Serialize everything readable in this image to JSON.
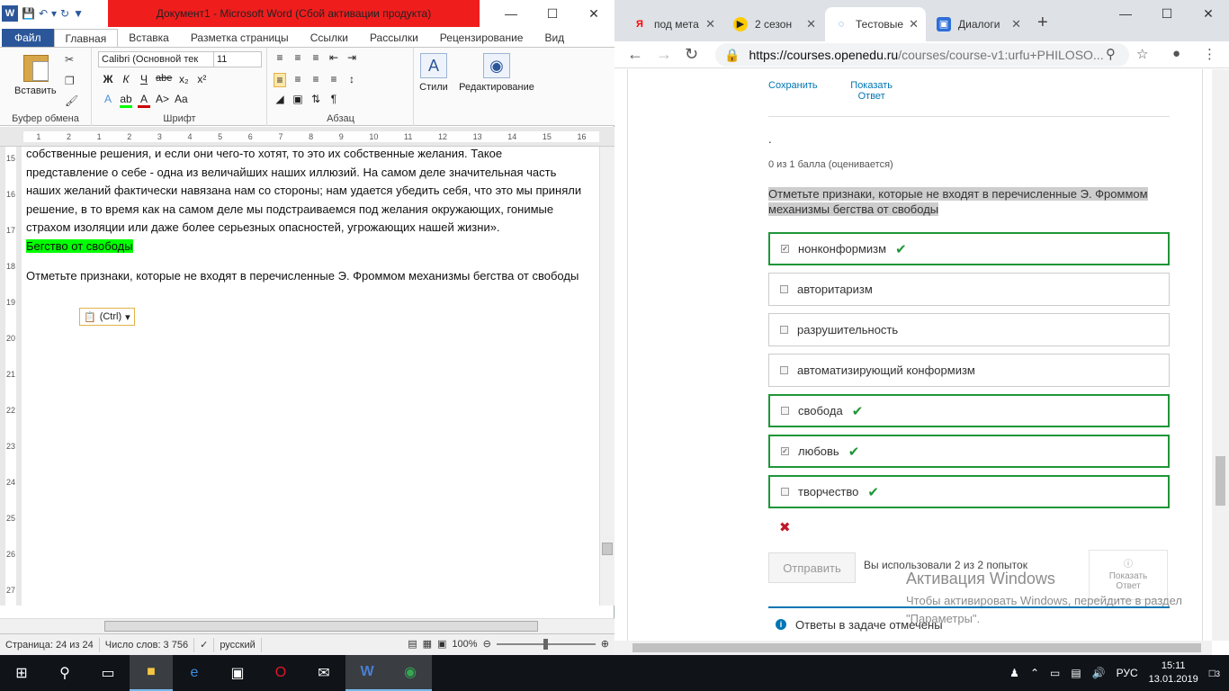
{
  "word": {
    "title": "Документ1  -  Microsoft Word (Сбой активации продукта)",
    "tabs": [
      "Файл",
      "Главная",
      "Вставка",
      "Разметка страницы",
      "Ссылки",
      "Рассылки",
      "Рецензирование",
      "Вид"
    ],
    "ribbon": {
      "paste_label": "Вставить",
      "font_name": "Calibri (Основной тек",
      "font_size": "11",
      "styles_label": "Стили",
      "editing_label": "Редактирование",
      "groups": {
        "clipboard": "Буфер обмена",
        "font": "Шрифт",
        "paragraph": "Абзац"
      },
      "format_buttons": [
        "Ж",
        "К",
        "Ч",
        "abe",
        "x₂",
        "x²"
      ]
    },
    "ruler_ticks": [
      "1",
      "2",
      "1",
      "2",
      "3",
      "4",
      "5",
      "6",
      "7",
      "8",
      "9",
      "10",
      "11",
      "12",
      "13",
      "14",
      "15",
      "16"
    ],
    "vruler_ticks": [
      "15",
      "16",
      "17",
      "18",
      "19",
      "20",
      "21",
      "22",
      "23",
      "24",
      "25",
      "26",
      "27"
    ],
    "document": {
      "para1": "собственные решения, и если они чего-то хотят, то это их собственные желания. Такое представление о себе - одна из величайших наших иллюзий. На самом деле значительная часть наших желаний фактически навязана нам со стороны; нам удается убедить себя, что это мы приняли решение, в то время как на самом деле мы подстраиваемся под желания окружающих, гонимые страхом изоляции или даже более серьезных опасностей, угрожающих нашей жизни».",
      "highlight": "Бегство от свободы",
      "para2": "Отметьте признаки, которые не входят в перечисленные Э. Фроммом механизмы бегства от свободы",
      "paste_tag": "(Ctrl)"
    },
    "status": {
      "page": "Страница: 24 из 24",
      "words": "Число слов: 3 756",
      "lang": "русский",
      "zoom": "100%"
    }
  },
  "browser": {
    "tabs": [
      {
        "label": "под мета",
        "icon": "Я",
        "color": "#ff0000"
      },
      {
        "label": "2 сезон",
        "icon": "▶",
        "color": "#ffcc00"
      },
      {
        "label": "Тестовые",
        "icon": "◌",
        "color": "#1a73e8"
      },
      {
        "label": "Диалоги",
        "icon": "▣",
        "color": "#2d6ed8"
      }
    ],
    "url_host": "https://courses.openedu.ru",
    "url_path": "/courses/course-v1:urfu+PHILOSO...",
    "top_actions": {
      "save": "Сохранить",
      "show_answer": "Показать Ответ"
    },
    "dot": ".",
    "score": "0 из 1 балла (оценивается)",
    "question": "Отметьте признаки, которые не входят в перечисленные Э. Фроммом механизмы бегства от свободы",
    "options": [
      {
        "label": "нонконформизм",
        "checked": true,
        "correct": true
      },
      {
        "label": "авторитаризм",
        "checked": false,
        "correct": false
      },
      {
        "label": "разрушительность",
        "checked": false,
        "correct": false
      },
      {
        "label": "автоматизирующий конформизм",
        "checked": false,
        "correct": false
      },
      {
        "label": "свобода",
        "checked": false,
        "correct": true
      },
      {
        "label": "любовь",
        "checked": true,
        "correct": true
      },
      {
        "label": "творчество",
        "checked": false,
        "correct": true
      }
    ],
    "submit_label": "Отправить",
    "attempts": "Вы использовали 2 из 2 попыток",
    "show_answer": "Показать Ответ",
    "info": "Ответы в задаче отмечены",
    "activation_title": "Активация Windows",
    "activation_text": "Чтобы активировать Windows, перейдите в раздел \"Параметры\"."
  },
  "taskbar": {
    "lang": "РУС",
    "time": "15:11",
    "date": "13.01.2019",
    "notifications": "3"
  }
}
